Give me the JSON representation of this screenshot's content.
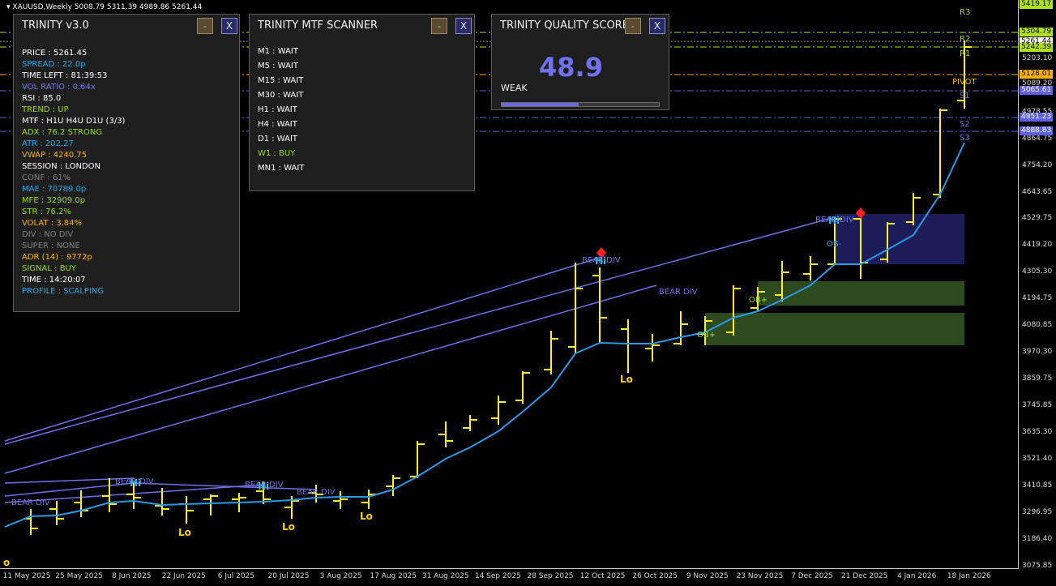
{
  "window": {
    "title": "XAUUSD,Weekly",
    "ohlc": "5008.79 5311.39 4989.86 5261.44"
  },
  "price_scale": {
    "ticks": [
      "5203.10",
      "5089.20",
      "4978.55",
      "4864.75",
      "4754.20",
      "4643.65",
      "4529.75",
      "4419.20",
      "4305.30",
      "4194.75",
      "4080.85",
      "3970.30",
      "3859.75",
      "3745.85",
      "3635.30",
      "3521.40",
      "3410.85",
      "3296.95",
      "3186.40",
      "3075.85"
    ],
    "tags": [
      {
        "text": "5419.17",
        "bg": "#b0e020",
        "fg": "#000"
      },
      {
        "text": "5304.79",
        "bg": "#b0e020",
        "fg": "#000"
      },
      {
        "text": "5261.44",
        "bg": "#ffffff",
        "fg": "#000"
      },
      {
        "text": "5242.39",
        "bg": "#b0e020",
        "fg": "#000"
      },
      {
        "text": "5128.01",
        "bg": "#ffb000",
        "fg": "#000"
      },
      {
        "text": "5065.61",
        "bg": "#6060e0",
        "fg": "#fff"
      },
      {
        "text": "4951.23",
        "bg": "#6060e0",
        "fg": "#fff"
      },
      {
        "text": "4888.83",
        "bg": "#6060e0",
        "fg": "#fff"
      }
    ]
  },
  "time_scale": [
    "11 May 2025",
    "25 May 2025",
    "8 Jun 2025",
    "22 Jun 2025",
    "6 Jul 2025",
    "20 Jul 2025",
    "3 Aug 2025",
    "17 Aug 2025",
    "31 Aug 2025",
    "14 Sep 2025",
    "28 Sep 2025",
    "12 Oct 2025",
    "26 Oct 2025",
    "9 Nov 2025",
    "23 Nov 2025",
    "7 Dec 2025",
    "21 Dec 2025",
    "4 Jan 2026",
    "18 Jan 2026"
  ],
  "pivots": {
    "R3": "R3",
    "R2": "R2",
    "R1": "R1",
    "PIVOT": "PIVOT",
    "S1": "S1",
    "S2": "S2",
    "S3": "S3"
  },
  "labels": {
    "bear_div": "BEAR DIV",
    "hi": "Hi",
    "lo": "Lo",
    "ob_minus": "OB-",
    "ob_plus": "OB+"
  },
  "trinity": {
    "title": "TRINITY v3.0",
    "min_label": "-",
    "close_label": "X",
    "rows": [
      {
        "label": "PRICE",
        "value": "5261.45",
        "color": "#ffffff"
      },
      {
        "label": "SPREAD",
        "value": "22.0p",
        "color": "#2aa8e8"
      },
      {
        "label": "TIME LEFT",
        "value": "81:39:53",
        "color": "#ffffff"
      },
      {
        "label": "VOL RATIO",
        "value": "0.64x",
        "color": "#7878f0"
      },
      {
        "label": "RSI",
        "value": "85.0",
        "color": "#ffffff"
      },
      {
        "label": "TREND",
        "value": "UP",
        "color": "#9adc1e"
      },
      {
        "label": "MTF",
        "value": "H1U H4U D1U (3/3)",
        "color": "#ffffff"
      },
      {
        "label": "ADX",
        "value": "76.2 STRONG",
        "color": "#9adc1e"
      },
      {
        "label": "ATR",
        "value": "202.27",
        "color": "#2aa8e8"
      },
      {
        "label": "VWAP",
        "value": "4240.75",
        "color": "#ffb400"
      },
      {
        "label": "SESSION",
        "value": "LONDON",
        "color": "#ffffff"
      },
      {
        "label": "CONF",
        "value": "61%",
        "color": "#808080"
      },
      {
        "label": "MAE",
        "value": "70789.0p",
        "color": "#2aa8e8"
      },
      {
        "label": "MFE",
        "value": "32909.0p",
        "color": "#9adc1e"
      },
      {
        "label": "STR",
        "value": "76.2%",
        "color": "#9adc1e"
      },
      {
        "label": "VOLAT",
        "value": "3.84%",
        "color": "#ffb400"
      },
      {
        "label": "DIV",
        "value": "NO DIV",
        "color": "#808080"
      },
      {
        "label": "SUPER",
        "value": "NONE",
        "color": "#808080"
      },
      {
        "label": "ADR (14)",
        "value": "9772p",
        "color": "#ffb400"
      },
      {
        "label": "SIGNAL",
        "value": "BUY",
        "color": "#9adc1e"
      },
      {
        "label": "TIME",
        "value": "14:20:07",
        "color": "#ffffff"
      },
      {
        "label": "PROFILE",
        "value": "SCALPING",
        "color": "#2aa8e8"
      }
    ]
  },
  "mtf_scanner": {
    "title": "TRINITY MTF SCANNER",
    "min_label": "-",
    "close_label": "X",
    "rows": [
      {
        "tf": "M1",
        "status": "WAIT",
        "color": "#ffffff"
      },
      {
        "tf": "M5",
        "status": "WAIT",
        "color": "#ffffff"
      },
      {
        "tf": "M15",
        "status": "WAIT",
        "color": "#ffffff"
      },
      {
        "tf": "M30",
        "status": "WAIT",
        "color": "#ffffff"
      },
      {
        "tf": "H1",
        "status": "WAIT",
        "color": "#ffffff"
      },
      {
        "tf": "H4",
        "status": "WAIT",
        "color": "#ffffff"
      },
      {
        "tf": "D1",
        "status": "WAIT",
        "color": "#ffffff"
      },
      {
        "tf": "W1",
        "status": "BUY",
        "color": "#9adc1e"
      },
      {
        "tf": "MN1",
        "status": "WAIT",
        "color": "#ffffff"
      }
    ]
  },
  "quality": {
    "title": "TRINITY QUALITY SCORE",
    "min_label": "-",
    "close_label": "X",
    "score": "48.9",
    "grade": "WEAK",
    "progress": 0.489
  }
}
